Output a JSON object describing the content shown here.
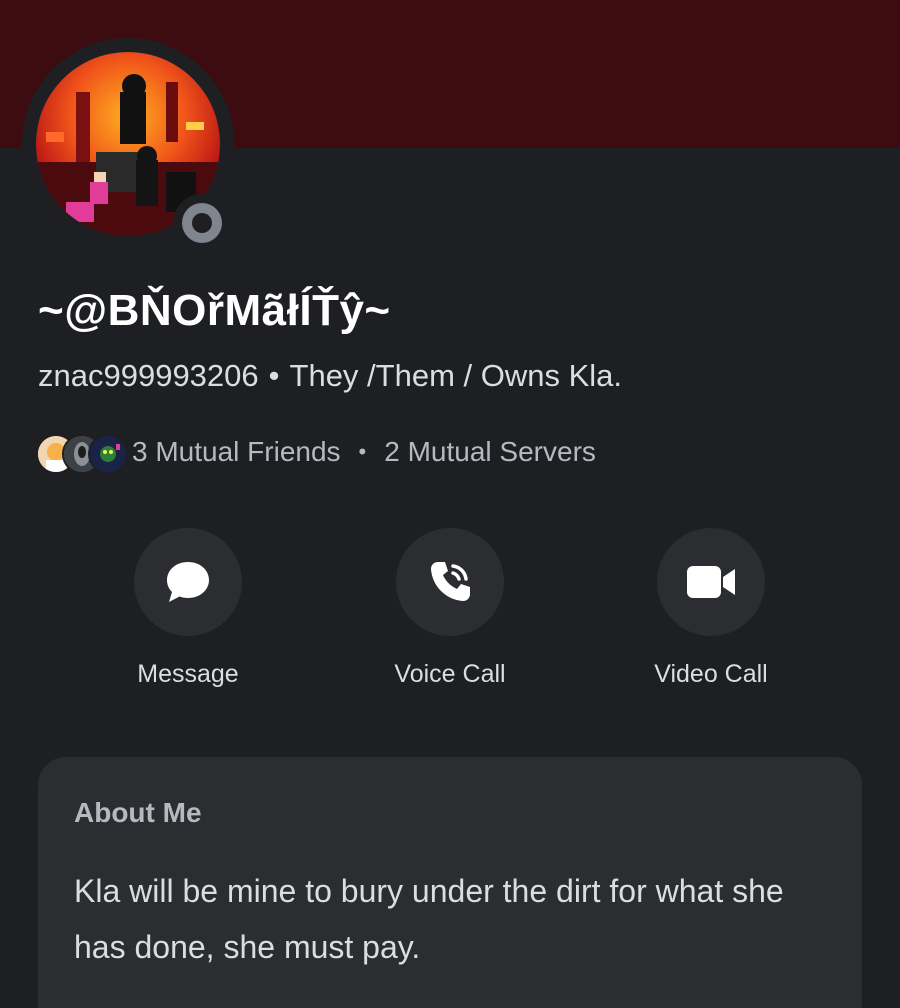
{
  "profile": {
    "display_name": "~@BŇOřMãłÍŤŷ~",
    "username": "znac999993206",
    "pronouns": "They /Them / Owns Kla.",
    "separator": "•",
    "status": "offline"
  },
  "mutuals": {
    "friends_label": "3 Mutual Friends",
    "servers_label": "2 Mutual Servers",
    "separator": "•"
  },
  "actions": [
    {
      "label": "Message",
      "icon": "chat-bubble-icon"
    },
    {
      "label": "Voice Call",
      "icon": "phone-icon"
    },
    {
      "label": "Video Call",
      "icon": "video-camera-icon"
    }
  ],
  "about": {
    "title": "About Me",
    "text": "Kla will be mine to bury under the dirt for what she has done, she must pay."
  },
  "colors": {
    "banner": "#3d0c10",
    "background": "#1e1f22",
    "card": "#2b2d31",
    "status_offline": "#80848e"
  }
}
